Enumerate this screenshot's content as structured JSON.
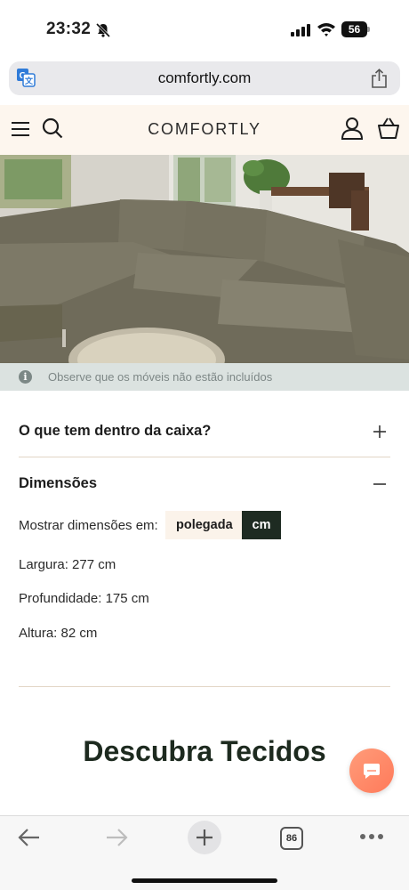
{
  "status_bar": {
    "time": "23:32",
    "battery": "56",
    "icons": [
      "bell-muted-icon",
      "signal-icon",
      "wifi-icon",
      "battery-icon"
    ]
  },
  "browser": {
    "url": "comfortly.com",
    "icons": [
      "translate-icon",
      "share-icon"
    ]
  },
  "header": {
    "logo": "COMFORTLY",
    "icons": [
      "menu-icon",
      "search-icon",
      "account-icon",
      "cart-icon"
    ]
  },
  "notice": {
    "text": "Observe que os móveis não estão incluídos"
  },
  "accordions": {
    "box": {
      "title": "O que tem dentro da caixa?",
      "expanded": false
    },
    "dimensions": {
      "title": "Dimensões",
      "expanded": true
    }
  },
  "dimensions": {
    "show_label": "Mostrar dimensões em:",
    "units": [
      "polegada",
      "cm"
    ],
    "selected_unit": "cm",
    "width": "Largura: 277 cm",
    "depth": "Profundidade: 175 cm",
    "height": "Altura: 82 cm"
  },
  "section": {
    "title": "Descubra Tecidos"
  },
  "toolbar": {
    "tab_count": "86",
    "icons": [
      "back-arrow-icon",
      "forward-arrow-icon",
      "new-tab-icon",
      "tabs-icon",
      "more-icon"
    ]
  },
  "colors": {
    "header_bg": "#fdf6ee",
    "notice_bg": "#dbe2e0",
    "active_unit_bg": "#1e2b22",
    "heading_color": "#1d2a1f",
    "chat_bubble": "#ff8a6a"
  }
}
